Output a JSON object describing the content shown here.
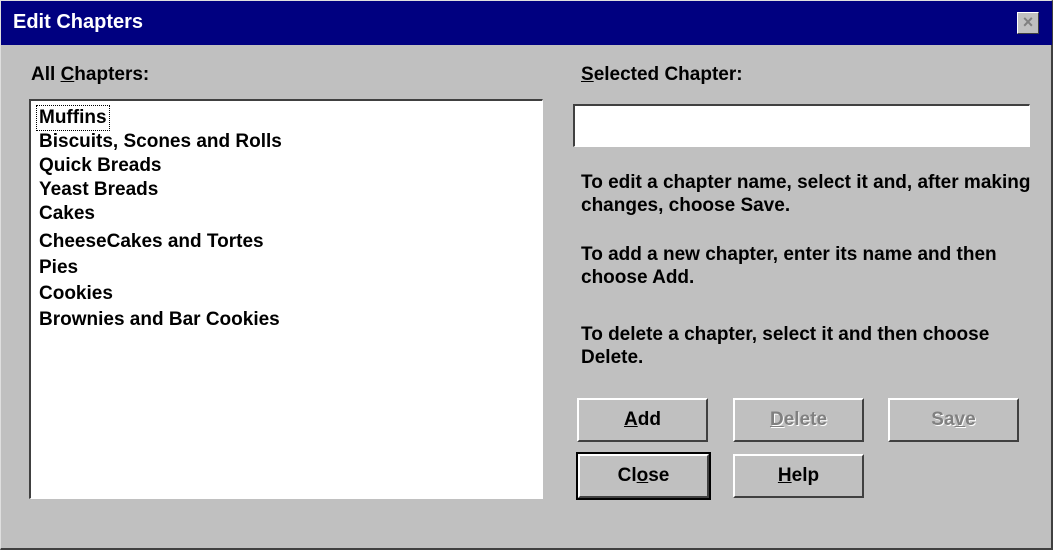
{
  "window": {
    "title": "Edit Chapters",
    "close_glyph": "×"
  },
  "all_chapters": {
    "label_pre": "All ",
    "label_key": "C",
    "label_post": "hapters:",
    "items": [
      "Muffins",
      "Biscuits, Scones and Rolls",
      "Quick Breads",
      "Yeast Breads",
      "Cakes",
      "CheeseCakes and Tortes",
      "Pies",
      "Cookies",
      "Brownies and Bar Cookies"
    ]
  },
  "selected_chapter": {
    "label_key": "S",
    "label_post": "elected Chapter:",
    "value": ""
  },
  "instructions": {
    "edit": "To edit a chapter name, select it and, after making changes, choose Save.",
    "add": "To add a new chapter, enter its name and then choose Add.",
    "delete": "To delete a chapter, select it and then choose Delete."
  },
  "buttons": {
    "add": {
      "key": "A",
      "rest": "dd"
    },
    "delete": {
      "key": "D",
      "rest": "elete"
    },
    "save": {
      "pre": "Sa",
      "key": "v",
      "post": "e"
    },
    "close": {
      "pre": "Cl",
      "key": "o",
      "post": "se"
    },
    "help": {
      "key": "H",
      "rest": "elp"
    }
  }
}
